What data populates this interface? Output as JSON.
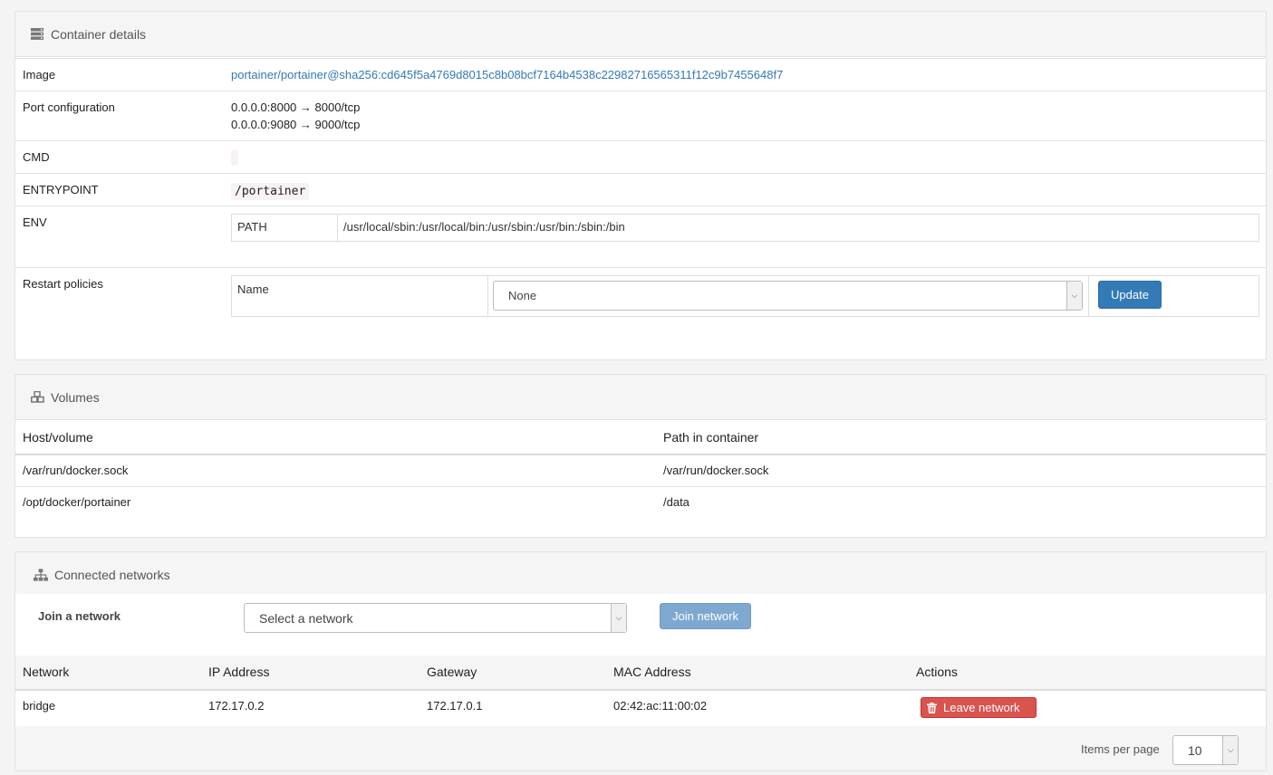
{
  "details": {
    "title": "Container details",
    "image_label": "Image",
    "image_value": "portainer/portainer@sha256:cd645f5a4769d8015c8b08bcf7164b4538c22982716565311f12c9b7455648f7",
    "ports_label": "Port configuration",
    "ports": [
      "0.0.0.0:8000 → 8000/tcp",
      "0.0.0.0:9080 → 9000/tcp"
    ],
    "cmd_label": "CMD",
    "cmd_value": "",
    "entrypoint_label": "ENTRYPOINT",
    "entrypoint_value": "/portainer",
    "env_label": "ENV",
    "env": [
      {
        "key": "PATH",
        "value": "/usr/local/sbin:/usr/local/bin:/usr/sbin:/usr/bin:/sbin:/bin"
      }
    ],
    "restart_label": "Restart policies",
    "restart_name_label": "Name",
    "restart_selected": "None",
    "update_label": "Update"
  },
  "volumes": {
    "title": "Volumes",
    "headers": [
      "Host/volume",
      "Path in container"
    ],
    "rows": [
      [
        "/var/run/docker.sock",
        "/var/run/docker.sock"
      ],
      [
        "/opt/docker/portainer",
        "/data"
      ]
    ]
  },
  "networks": {
    "title": "Connected networks",
    "join_label": "Join a network",
    "select_placeholder": "Select a network",
    "join_button": "Join network",
    "headers": [
      "Network",
      "IP Address",
      "Gateway",
      "MAC Address",
      "Actions"
    ],
    "rows": [
      {
        "network": "bridge",
        "ip": "172.17.0.2",
        "gateway": "172.17.0.1",
        "mac": "02:42:ac:11:00:02",
        "action": "Leave network"
      }
    ],
    "items_per_page_label": "Items per page",
    "items_per_page": "10"
  },
  "colors": {
    "link": "#337ab7",
    "primary": "#337ab7",
    "danger": "#d9534f"
  },
  "icons": [
    "server-icon",
    "cubes-icon",
    "sitemap-icon",
    "trash-icon",
    "chevron-down-icon"
  ]
}
